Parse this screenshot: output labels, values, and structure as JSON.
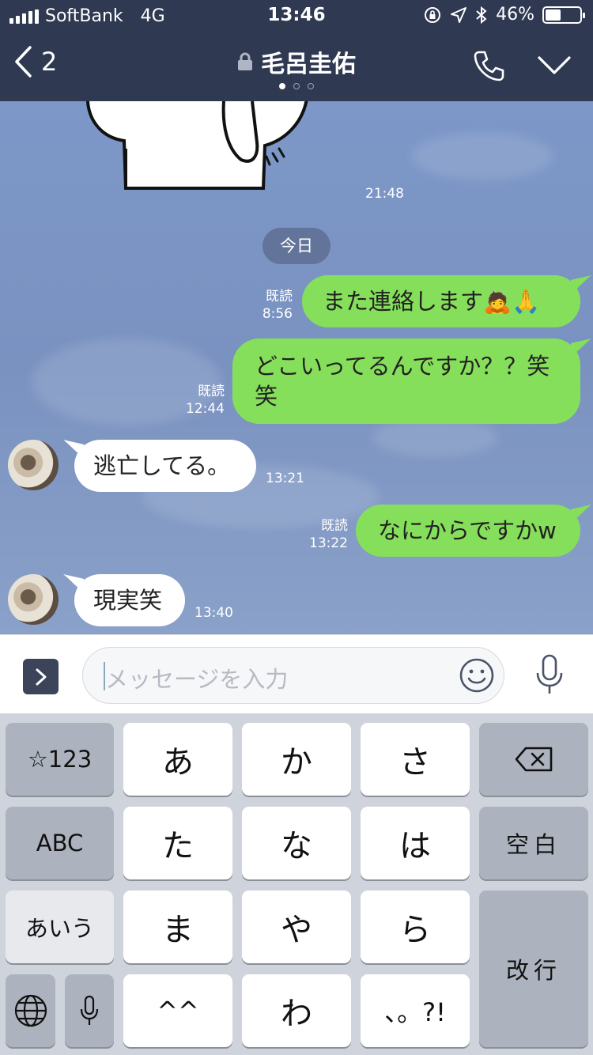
{
  "status_bar": {
    "carrier": "SoftBank",
    "network": "4G",
    "time": "13:46",
    "battery": "46%",
    "battery_level": 0.46
  },
  "header": {
    "back_count": "2",
    "contact_name": "毛呂圭佑",
    "page_count": 3,
    "active_page": 1
  },
  "chat": {
    "sticker_time": "21:48",
    "date_divider": "今日",
    "read_label": "既読",
    "messages": [
      {
        "dir": "out",
        "text": "また連絡します🙇🙏",
        "time": "8:56",
        "read": true
      },
      {
        "dir": "out",
        "text_line1": "どこいってるんですか？？笑",
        "text_line2": "笑",
        "time": "12:44",
        "read": true
      },
      {
        "dir": "in",
        "text": "逃亡してる。",
        "time": "13:21"
      },
      {
        "dir": "out",
        "text": "なにからですかw",
        "time": "13:22",
        "read": true
      },
      {
        "dir": "in",
        "text": "現実笑",
        "time": "13:40"
      }
    ]
  },
  "input": {
    "placeholder": "メッセージを入力"
  },
  "keyboard": {
    "row1": [
      "☆123",
      "あ",
      "か",
      "さ"
    ],
    "row2": [
      "ABC",
      "た",
      "な",
      "は",
      "空白"
    ],
    "row3": [
      "あいう",
      "ま",
      "や",
      "ら",
      "改行"
    ],
    "row4": [
      "^^",
      "わ",
      "、。?!"
    ],
    "icons": [
      "backspace-icon",
      "globe-icon",
      "microphone-icon"
    ]
  }
}
